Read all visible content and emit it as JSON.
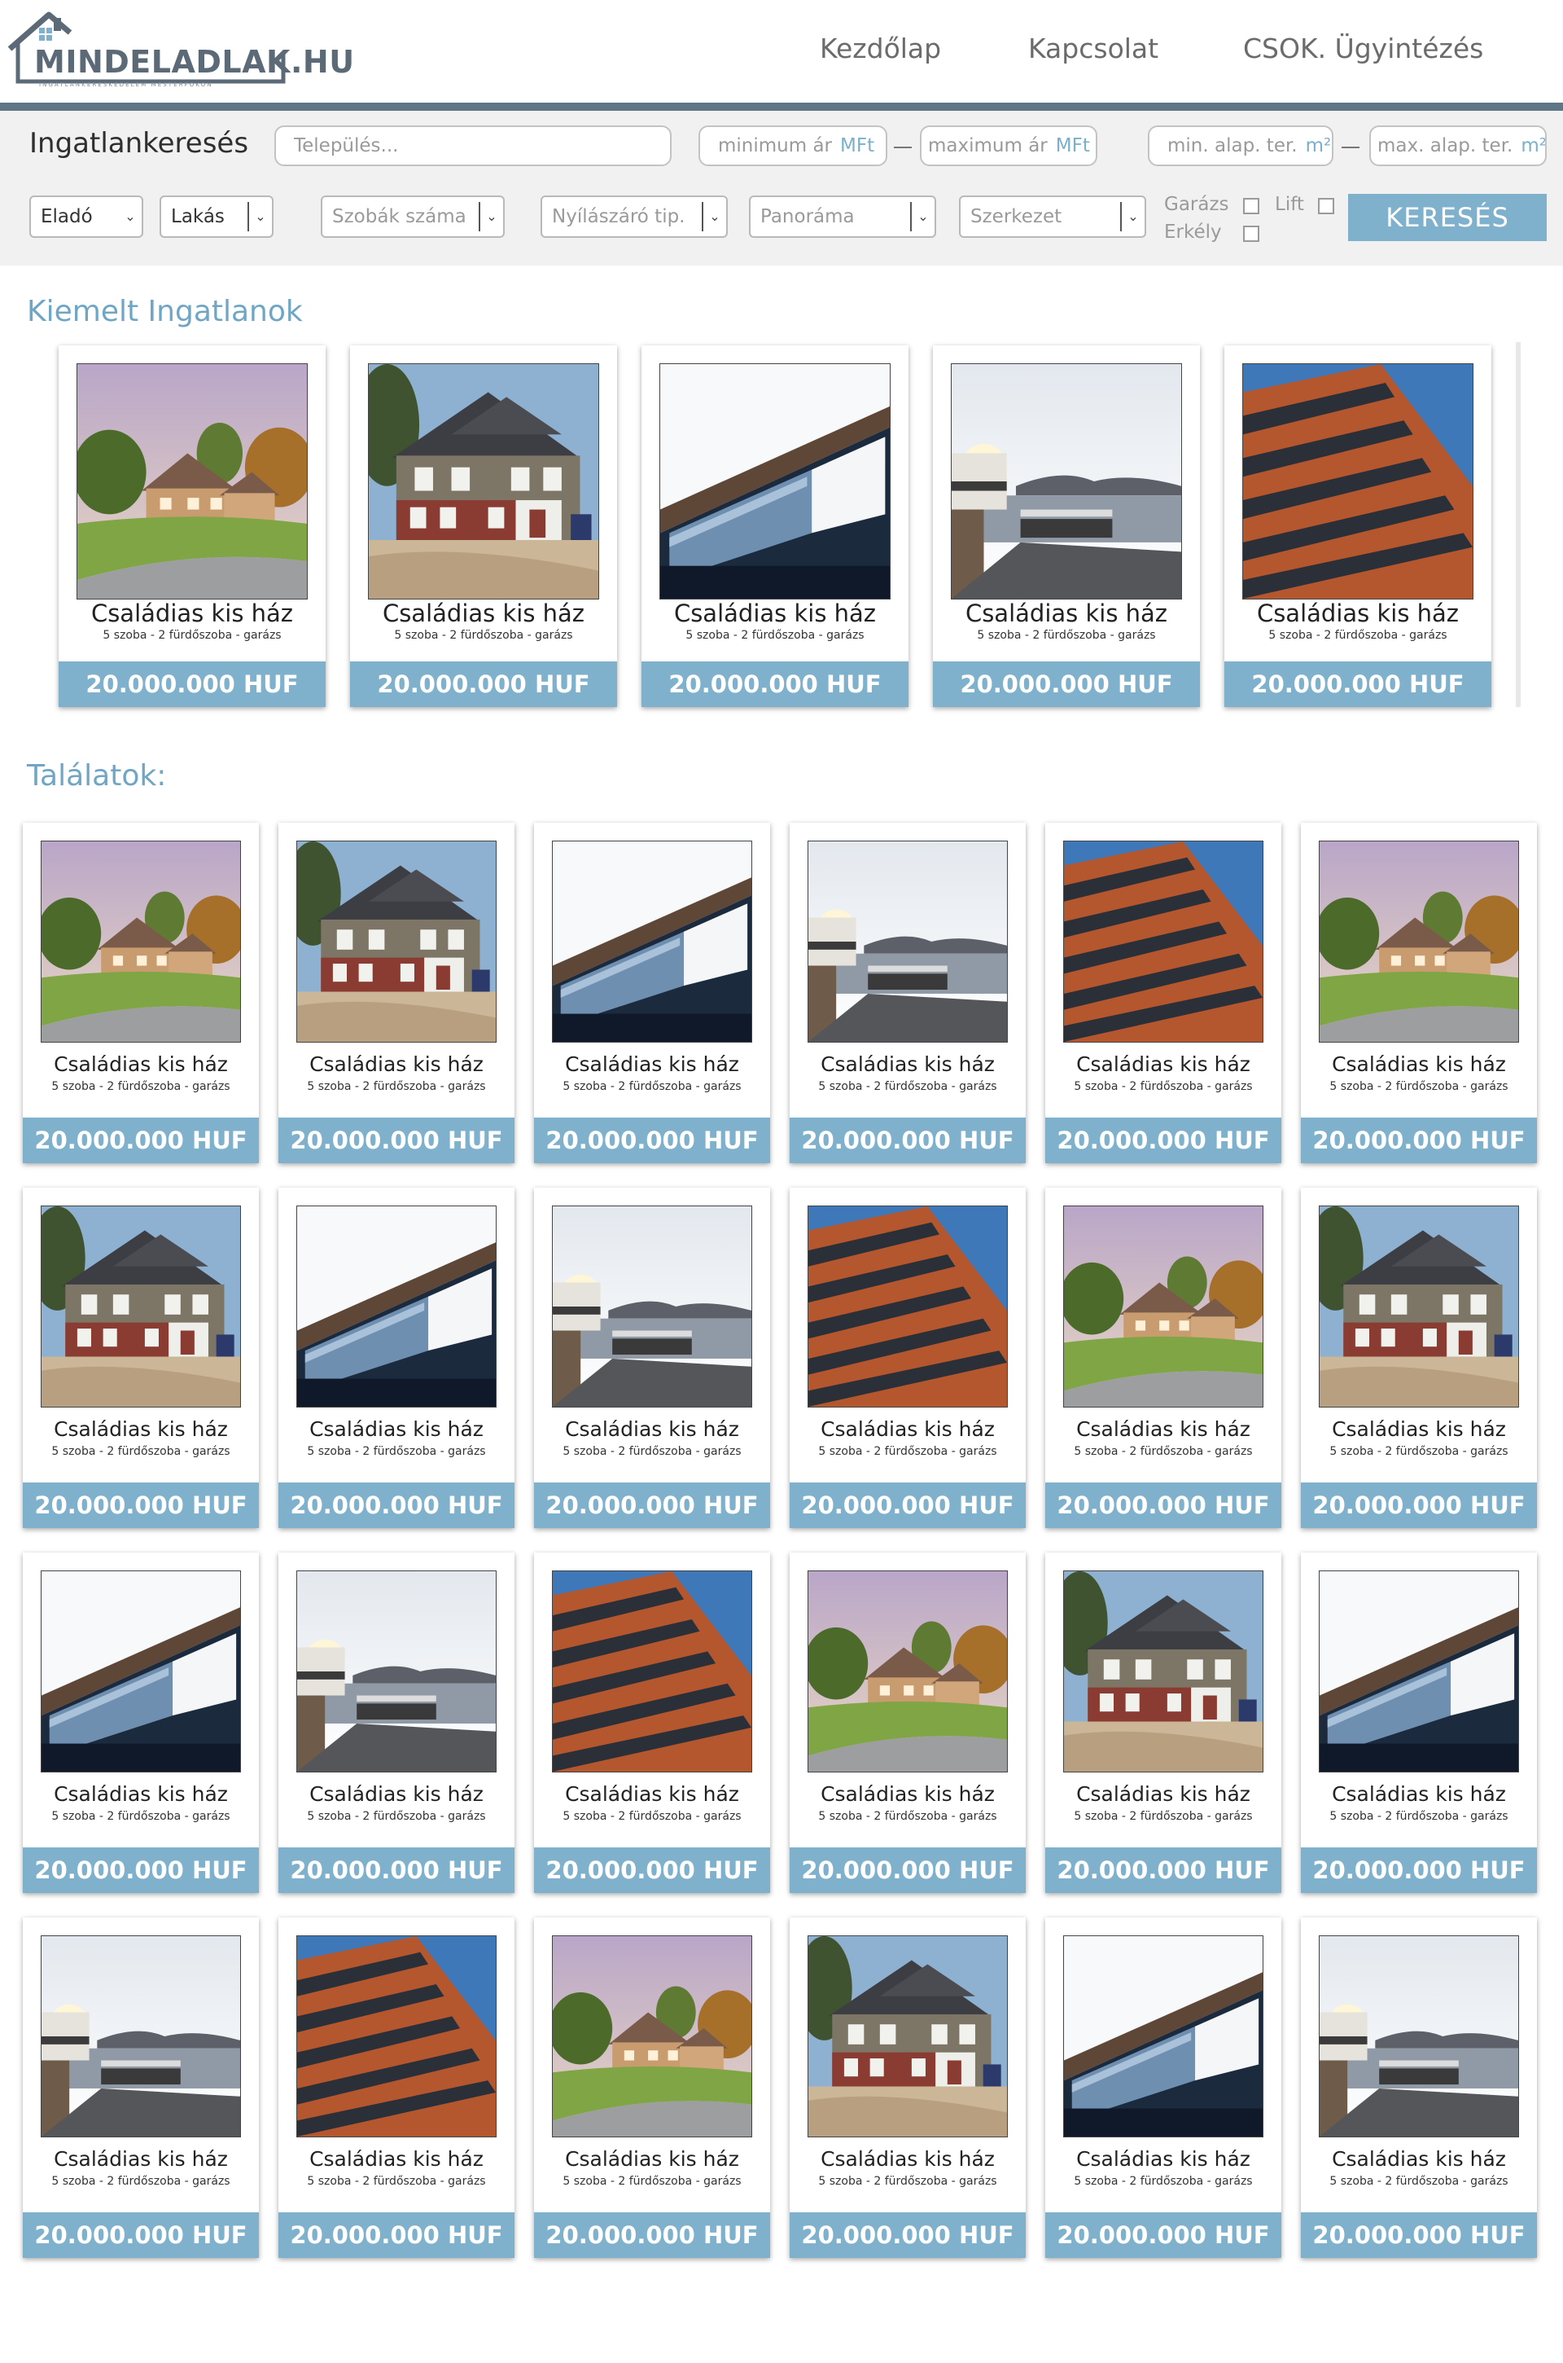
{
  "brand": {
    "name": "MINDELADLAK.HU",
    "tagline": "INGATLANKERESKEDELEM MESTERFOKON"
  },
  "nav": {
    "items": [
      "Kezdőlap",
      "Kapcsolat",
      "CSOK. Ügyintézés"
    ]
  },
  "search": {
    "title": "Ingatlankeresés",
    "settlement_placeholder": "Település...",
    "price_min_placeholder": "minimum ár",
    "price_max_placeholder": "maximum ár",
    "price_unit": "MFt",
    "area_min_placeholder": "min. alap. ter.",
    "area_max_placeholder": "max. alap. ter.",
    "area_unit": "m²",
    "listing_type": "Eladó",
    "property_type": "Lakás",
    "rooms_placeholder": "Szobák száma",
    "window_placeholder": "Nyílászáró tip.",
    "view_placeholder": "Panoráma",
    "structure_placeholder": "Szerkezet",
    "garage_label": "Garázs",
    "lift_label": "Lift",
    "balcony_label": "Erkély",
    "button_label": "KERESÉS"
  },
  "featured": {
    "title": "Kiemelt Ingatlanok",
    "items": [
      {
        "image": "house-suburban",
        "title": "Családias kis ház",
        "details": "5 szoba - 2 fürdőszoba - garázs",
        "price": "20.000.000 HUF"
      },
      {
        "image": "house-colonial",
        "title": "Családias kis ház",
        "details": "5 szoba - 2 fürdőszoba - garázs",
        "price": "20.000.000 HUF"
      },
      {
        "image": "house-modern",
        "title": "Családias kis ház",
        "details": "5 szoba - 2 fürdőszoba - garázs",
        "price": "20.000.000 HUF"
      },
      {
        "image": "house-lake",
        "title": "Családias kis ház",
        "details": "5 szoba - 2 fürdőszoba - garázs",
        "price": "20.000.000 HUF"
      },
      {
        "image": "building-brick",
        "title": "Családias kis ház",
        "details": "5 szoba - 2 fürdőszoba - garázs",
        "price": "20.000.000 HUF"
      }
    ]
  },
  "results": {
    "title": "Találatok:",
    "items": [
      {
        "image": "house-suburban",
        "title": "Családias kis ház",
        "details": "5 szoba - 2 fürdőszoba - garázs",
        "price": "20.000.000 HUF"
      },
      {
        "image": "house-colonial",
        "title": "Családias kis ház",
        "details": "5 szoba - 2 fürdőszoba - garázs",
        "price": "20.000.000 HUF"
      },
      {
        "image": "house-modern",
        "title": "Családias kis ház",
        "details": "5 szoba - 2 fürdőszoba - garázs",
        "price": "20.000.000 HUF"
      },
      {
        "image": "house-lake",
        "title": "Családias kis ház",
        "details": "5 szoba - 2 fürdőszoba - garázs",
        "price": "20.000.000 HUF"
      },
      {
        "image": "building-brick",
        "title": "Családias kis ház",
        "details": "5 szoba - 2 fürdőszoba - garázs",
        "price": "20.000.000 HUF"
      },
      {
        "image": "house-suburban",
        "title": "Családias kis ház",
        "details": "5 szoba - 2 fürdőszoba - garázs",
        "price": "20.000.000 HUF"
      },
      {
        "image": "house-colonial",
        "title": "Családias kis ház",
        "details": "5 szoba - 2 fürdőszoba - garázs",
        "price": "20.000.000 HUF"
      },
      {
        "image": "house-modern",
        "title": "Családias kis ház",
        "details": "5 szoba - 2 fürdőszoba - garázs",
        "price": "20.000.000 HUF"
      },
      {
        "image": "house-lake",
        "title": "Családias kis ház",
        "details": "5 szoba - 2 fürdőszoba - garázs",
        "price": "20.000.000 HUF"
      },
      {
        "image": "building-brick",
        "title": "Családias kis ház",
        "details": "5 szoba - 2 fürdőszoba - garázs",
        "price": "20.000.000 HUF"
      },
      {
        "image": "house-suburban",
        "title": "Családias kis ház",
        "details": "5 szoba - 2 fürdőszoba - garázs",
        "price": "20.000.000 HUF"
      },
      {
        "image": "house-colonial",
        "title": "Családias kis ház",
        "details": "5 szoba - 2 fürdőszoba - garázs",
        "price": "20.000.000 HUF"
      },
      {
        "image": "house-modern",
        "title": "Családias kis ház",
        "details": "5 szoba - 2 fürdőszoba - garázs",
        "price": "20.000.000 HUF"
      },
      {
        "image": "house-lake",
        "title": "Családias kis ház",
        "details": "5 szoba - 2 fürdőszoba - garázs",
        "price": "20.000.000 HUF"
      },
      {
        "image": "building-brick",
        "title": "Családias kis ház",
        "details": "5 szoba - 2 fürdőszoba - garázs",
        "price": "20.000.000 HUF"
      },
      {
        "image": "house-suburban",
        "title": "Családias kis ház",
        "details": "5 szoba - 2 fürdőszoba - garázs",
        "price": "20.000.000 HUF"
      },
      {
        "image": "house-colonial",
        "title": "Családias kis ház",
        "details": "5 szoba - 2 fürdőszoba - garázs",
        "price": "20.000.000 HUF"
      },
      {
        "image": "house-modern",
        "title": "Családias kis ház",
        "details": "5 szoba - 2 fürdőszoba - garázs",
        "price": "20.000.000 HUF"
      },
      {
        "image": "house-lake",
        "title": "Családias kis ház",
        "details": "5 szoba - 2 fürdőszoba - garázs",
        "price": "20.000.000 HUF"
      },
      {
        "image": "building-brick",
        "title": "Családias kis ház",
        "details": "5 szoba - 2 fürdőszoba - garázs",
        "price": "20.000.000 HUF"
      },
      {
        "image": "house-suburban",
        "title": "Családias kis ház",
        "details": "5 szoba - 2 fürdőszoba - garázs",
        "price": "20.000.000 HUF"
      },
      {
        "image": "house-colonial",
        "title": "Családias kis ház",
        "details": "5 szoba - 2 fürdőszoba - garázs",
        "price": "20.000.000 HUF"
      },
      {
        "image": "house-modern",
        "title": "Családias kis ház",
        "details": "5 szoba - 2 fürdőszoba - garázs",
        "price": "20.000.000 HUF"
      },
      {
        "image": "house-lake",
        "title": "Családias kis ház",
        "details": "5 szoba - 2 fürdőszoba - garázs",
        "price": "20.000.000 HUF"
      }
    ]
  },
  "colors": {
    "accent": "#7fb1cd",
    "heading": "#6fa6c5",
    "header_rule": "#5e7685",
    "panel": "#f1f1f1"
  }
}
